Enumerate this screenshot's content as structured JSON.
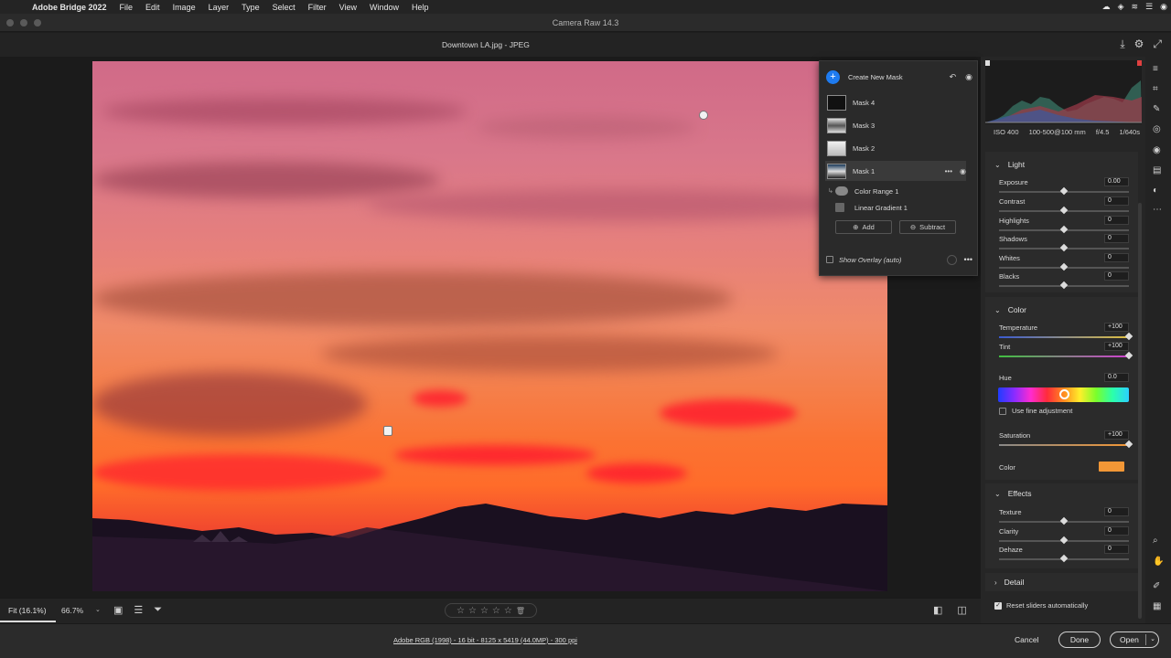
{
  "menubar": {
    "app_name": "Adobe Bridge 2022",
    "menus": [
      "File",
      "Edit",
      "Image",
      "Layer",
      "Type",
      "Select",
      "Filter",
      "View",
      "Window",
      "Help"
    ],
    "tray_icons": [
      "creative-cloud-icon",
      "dropbox-icon",
      "wifi-icon",
      "control-center-icon",
      "user-icon"
    ]
  },
  "window": {
    "title": "Camera Raw 14.3"
  },
  "file": {
    "name": "Downtown LA.jpg  -  JPEG"
  },
  "masks": {
    "create_label": "Create New Mask",
    "items": [
      {
        "label": "Mask 4"
      },
      {
        "label": "Mask 3"
      },
      {
        "label": "Mask 2"
      },
      {
        "label": "Mask 1"
      }
    ],
    "components": [
      {
        "label": "Color Range 1"
      },
      {
        "label": "Linear Gradient 1"
      }
    ],
    "add_label": "Add",
    "subtract_label": "Subtract",
    "overlay_label": "Show Overlay (auto)"
  },
  "exif": {
    "iso": "ISO 400",
    "lens": "100-500@100 mm",
    "aperture": "f/4.5",
    "shutter": "1/640s"
  },
  "light": {
    "title": "Light",
    "sliders": [
      {
        "name": "Exposure",
        "value": "0.00",
        "pos": 0.5
      },
      {
        "name": "Contrast",
        "value": "0",
        "pos": 0.5
      },
      {
        "name": "Highlights",
        "value": "0",
        "pos": 0.5
      },
      {
        "name": "Shadows",
        "value": "0",
        "pos": 0.5
      },
      {
        "name": "Whites",
        "value": "0",
        "pos": 0.5
      },
      {
        "name": "Blacks",
        "value": "0",
        "pos": 0.5
      }
    ]
  },
  "color": {
    "title": "Color",
    "temperature": {
      "name": "Temperature",
      "value": "+100",
      "pos": 1.0
    },
    "tint": {
      "name": "Tint",
      "value": "+100",
      "pos": 1.0
    },
    "hue": {
      "name": "Hue",
      "value": "0.0",
      "pos": 0.5
    },
    "fine_label": "Use fine adjustment",
    "saturation": {
      "name": "Saturation",
      "value": "+100",
      "pos": 1.0
    },
    "color_label": "Color",
    "swatch": "#f29736"
  },
  "effects": {
    "title": "Effects",
    "sliders": [
      {
        "name": "Texture",
        "value": "0",
        "pos": 0.5
      },
      {
        "name": "Clarity",
        "value": "0",
        "pos": 0.5
      },
      {
        "name": "Dehaze",
        "value": "0",
        "pos": 0.5
      }
    ]
  },
  "detail": {
    "title": "Detail"
  },
  "filmbar": {
    "fit": "Fit (16.1%)",
    "zoom": "66.7%"
  },
  "reset_label": "Reset sliders automatically",
  "bottom": {
    "info": "Adobe RGB (1998) - 16 bit - 8125 x 5419 (44.0MP) - 300 ppi",
    "cancel": "Cancel",
    "done": "Done",
    "open": "Open"
  }
}
